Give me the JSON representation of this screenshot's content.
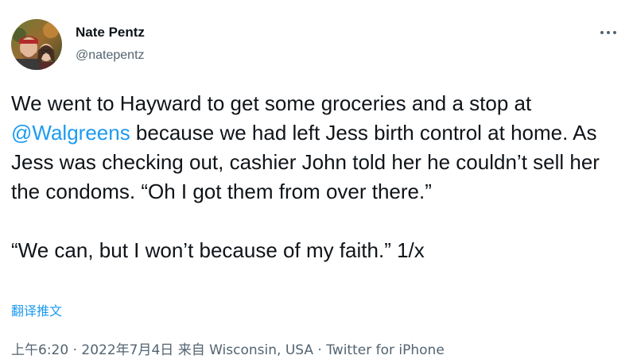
{
  "author": {
    "display_name": "Nate Pentz",
    "handle": "@natepentz"
  },
  "more_icon": "more-horizontal-icon",
  "tweet": {
    "text_before": "We went to Hayward to get some groceries and a stop at ",
    "mention": "@Walgreens",
    "text_after": " because we had left Jess birth control at home. As Jess was checking out, cashier John told her he couldn’t sell her the condoms. “Oh I got them from over there.”\n\n“We can, but I won’t because of my faith.” 1/x"
  },
  "translate_label": "翻译推文",
  "meta": {
    "time": "上午6:20",
    "separator": " · ",
    "date": "2022年7月4日",
    "location": "来自 Wisconsin, USA",
    "source": "Twitter for iPhone"
  },
  "colors": {
    "link": "#1d9bf0",
    "secondary_text": "#536471",
    "primary_text": "#0f1419"
  }
}
